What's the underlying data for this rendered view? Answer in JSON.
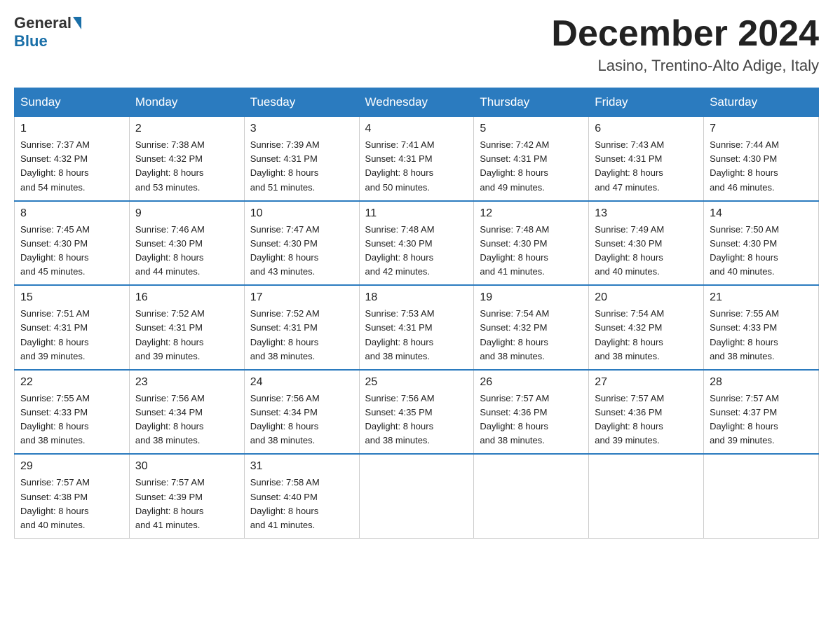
{
  "header": {
    "logo_general": "General",
    "logo_blue": "Blue",
    "month_title": "December 2024",
    "location": "Lasino, Trentino-Alto Adige, Italy"
  },
  "days_of_week": [
    "Sunday",
    "Monday",
    "Tuesday",
    "Wednesday",
    "Thursday",
    "Friday",
    "Saturday"
  ],
  "weeks": [
    [
      {
        "day": "1",
        "sunrise": "7:37 AM",
        "sunset": "4:32 PM",
        "daylight": "8 hours and 54 minutes."
      },
      {
        "day": "2",
        "sunrise": "7:38 AM",
        "sunset": "4:32 PM",
        "daylight": "8 hours and 53 minutes."
      },
      {
        "day": "3",
        "sunrise": "7:39 AM",
        "sunset": "4:31 PM",
        "daylight": "8 hours and 51 minutes."
      },
      {
        "day": "4",
        "sunrise": "7:41 AM",
        "sunset": "4:31 PM",
        "daylight": "8 hours and 50 minutes."
      },
      {
        "day": "5",
        "sunrise": "7:42 AM",
        "sunset": "4:31 PM",
        "daylight": "8 hours and 49 minutes."
      },
      {
        "day": "6",
        "sunrise": "7:43 AM",
        "sunset": "4:31 PM",
        "daylight": "8 hours and 47 minutes."
      },
      {
        "day": "7",
        "sunrise": "7:44 AM",
        "sunset": "4:30 PM",
        "daylight": "8 hours and 46 minutes."
      }
    ],
    [
      {
        "day": "8",
        "sunrise": "7:45 AM",
        "sunset": "4:30 PM",
        "daylight": "8 hours and 45 minutes."
      },
      {
        "day": "9",
        "sunrise": "7:46 AM",
        "sunset": "4:30 PM",
        "daylight": "8 hours and 44 minutes."
      },
      {
        "day": "10",
        "sunrise": "7:47 AM",
        "sunset": "4:30 PM",
        "daylight": "8 hours and 43 minutes."
      },
      {
        "day": "11",
        "sunrise": "7:48 AM",
        "sunset": "4:30 PM",
        "daylight": "8 hours and 42 minutes."
      },
      {
        "day": "12",
        "sunrise": "7:48 AM",
        "sunset": "4:30 PM",
        "daylight": "8 hours and 41 minutes."
      },
      {
        "day": "13",
        "sunrise": "7:49 AM",
        "sunset": "4:30 PM",
        "daylight": "8 hours and 40 minutes."
      },
      {
        "day": "14",
        "sunrise": "7:50 AM",
        "sunset": "4:30 PM",
        "daylight": "8 hours and 40 minutes."
      }
    ],
    [
      {
        "day": "15",
        "sunrise": "7:51 AM",
        "sunset": "4:31 PM",
        "daylight": "8 hours and 39 minutes."
      },
      {
        "day": "16",
        "sunrise": "7:52 AM",
        "sunset": "4:31 PM",
        "daylight": "8 hours and 39 minutes."
      },
      {
        "day": "17",
        "sunrise": "7:52 AM",
        "sunset": "4:31 PM",
        "daylight": "8 hours and 38 minutes."
      },
      {
        "day": "18",
        "sunrise": "7:53 AM",
        "sunset": "4:31 PM",
        "daylight": "8 hours and 38 minutes."
      },
      {
        "day": "19",
        "sunrise": "7:54 AM",
        "sunset": "4:32 PM",
        "daylight": "8 hours and 38 minutes."
      },
      {
        "day": "20",
        "sunrise": "7:54 AM",
        "sunset": "4:32 PM",
        "daylight": "8 hours and 38 minutes."
      },
      {
        "day": "21",
        "sunrise": "7:55 AM",
        "sunset": "4:33 PM",
        "daylight": "8 hours and 38 minutes."
      }
    ],
    [
      {
        "day": "22",
        "sunrise": "7:55 AM",
        "sunset": "4:33 PM",
        "daylight": "8 hours and 38 minutes."
      },
      {
        "day": "23",
        "sunrise": "7:56 AM",
        "sunset": "4:34 PM",
        "daylight": "8 hours and 38 minutes."
      },
      {
        "day": "24",
        "sunrise": "7:56 AM",
        "sunset": "4:34 PM",
        "daylight": "8 hours and 38 minutes."
      },
      {
        "day": "25",
        "sunrise": "7:56 AM",
        "sunset": "4:35 PM",
        "daylight": "8 hours and 38 minutes."
      },
      {
        "day": "26",
        "sunrise": "7:57 AM",
        "sunset": "4:36 PM",
        "daylight": "8 hours and 38 minutes."
      },
      {
        "day": "27",
        "sunrise": "7:57 AM",
        "sunset": "4:36 PM",
        "daylight": "8 hours and 39 minutes."
      },
      {
        "day": "28",
        "sunrise": "7:57 AM",
        "sunset": "4:37 PM",
        "daylight": "8 hours and 39 minutes."
      }
    ],
    [
      {
        "day": "29",
        "sunrise": "7:57 AM",
        "sunset": "4:38 PM",
        "daylight": "8 hours and 40 minutes."
      },
      {
        "day": "30",
        "sunrise": "7:57 AM",
        "sunset": "4:39 PM",
        "daylight": "8 hours and 41 minutes."
      },
      {
        "day": "31",
        "sunrise": "7:58 AM",
        "sunset": "4:40 PM",
        "daylight": "8 hours and 41 minutes."
      },
      null,
      null,
      null,
      null
    ]
  ],
  "labels": {
    "sunrise": "Sunrise:",
    "sunset": "Sunset:",
    "daylight": "Daylight:"
  }
}
